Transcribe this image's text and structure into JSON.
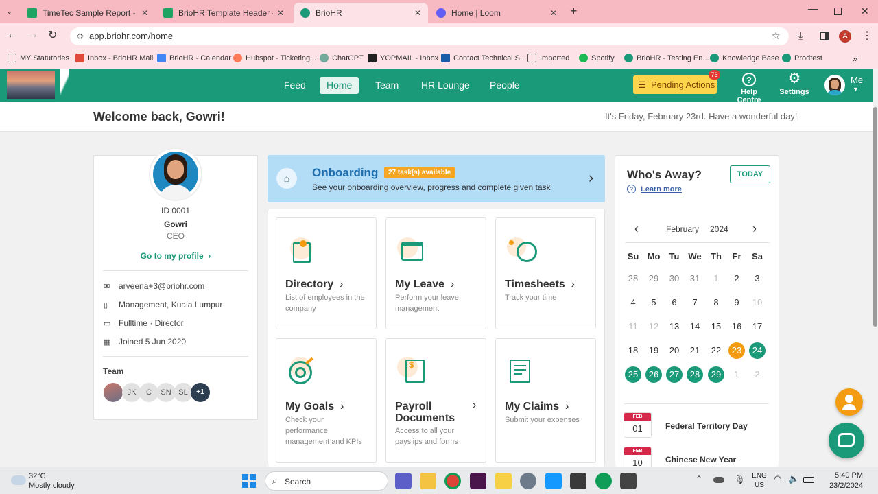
{
  "browser": {
    "tabs": [
      {
        "title": "TimeTec Sample Report - Goog",
        "color": "#1ea362"
      },
      {
        "title": "BrioHR Template Header - Goo",
        "color": "#1ea362"
      },
      {
        "title": "BrioHR",
        "color": "#1a9a79"
      },
      {
        "title": "Home | Loom",
        "color": "#625df5"
      }
    ],
    "url": "app.briohr.com/home",
    "profile_initial": "A",
    "bookmarks": [
      "MY Statutories",
      "Inbox - BrioHR Mail",
      "BrioHR - Calendar",
      "Hubspot - Ticketing...",
      "ChatGPT",
      "YOPMAIL - Inbox",
      "Contact Technical S...",
      "Imported",
      "Spotify",
      "BrioHR - Testing En...",
      "Knowledge Base",
      "Prodtest"
    ]
  },
  "nav": {
    "items": [
      "Feed",
      "Home",
      "Team",
      "HR Lounge",
      "People"
    ],
    "pending_label": "Pending Actions",
    "pending_count": "76",
    "help_label": "Help Centre",
    "settings_label": "Settings",
    "me_label": "Me"
  },
  "welcome": {
    "greeting": "Welcome back, Gowri!",
    "date_message": "It's Friday, February 23rd. Have a wonderful day!"
  },
  "profile": {
    "id": "ID 0001",
    "name": "Gowri",
    "role": "CEO",
    "profile_link": "Go to my profile",
    "email": "arveena+3@briohr.com",
    "department": "Management, Kuala Lumpur",
    "employment": "Fulltime · Director",
    "joined": "Joined 5 Jun 2020",
    "team_label": "Team",
    "team_members": [
      "JK",
      "C",
      "SN",
      "SL"
    ],
    "team_more": "+1"
  },
  "onboarding": {
    "title": "Onboarding",
    "badge": "27 task(s) available",
    "subtitle": "See your onboarding overview, progress and complete given task"
  },
  "tiles": [
    {
      "title": "Directory",
      "desc": "List of employees in the company"
    },
    {
      "title": "My Leave",
      "desc": "Perform your leave management"
    },
    {
      "title": "Timesheets",
      "desc": "Track your time"
    },
    {
      "title": "My Goals",
      "desc": "Check your performance management and KPIs"
    },
    {
      "title": "Payroll Documents",
      "desc": "Access to all your payslips and forms"
    },
    {
      "title": "My Claims",
      "desc": "Submit your expenses"
    }
  ],
  "away": {
    "title": "Who's Away?",
    "today_btn": "TODAY",
    "learn_more": "Learn more",
    "month": "February",
    "year": "2024",
    "weekdays": [
      "Su",
      "Mo",
      "Tu",
      "We",
      "Th",
      "Fr",
      "Sa"
    ],
    "weeks": [
      [
        "28",
        "29",
        "30",
        "31",
        "1",
        "2",
        "3"
      ],
      [
        "4",
        "5",
        "6",
        "7",
        "8",
        "9",
        "10"
      ],
      [
        "11",
        "12",
        "13",
        "14",
        "15",
        "16",
        "17"
      ],
      [
        "18",
        "19",
        "20",
        "21",
        "22",
        "23",
        "24"
      ],
      [
        "25",
        "26",
        "27",
        "28",
        "29",
        "1",
        "2"
      ]
    ],
    "holidays": [
      {
        "month": "FEB",
        "day": "01",
        "name": "Federal Territory Day"
      },
      {
        "month": "FEB",
        "day": "10",
        "name": "Chinese New Year"
      }
    ]
  },
  "taskbar": {
    "temp": "32°C",
    "weather": "Mostly cloudy",
    "search": "Search",
    "lang1": "ENG",
    "lang2": "US",
    "time": "5:40 PM",
    "date": "23/2/2024"
  }
}
